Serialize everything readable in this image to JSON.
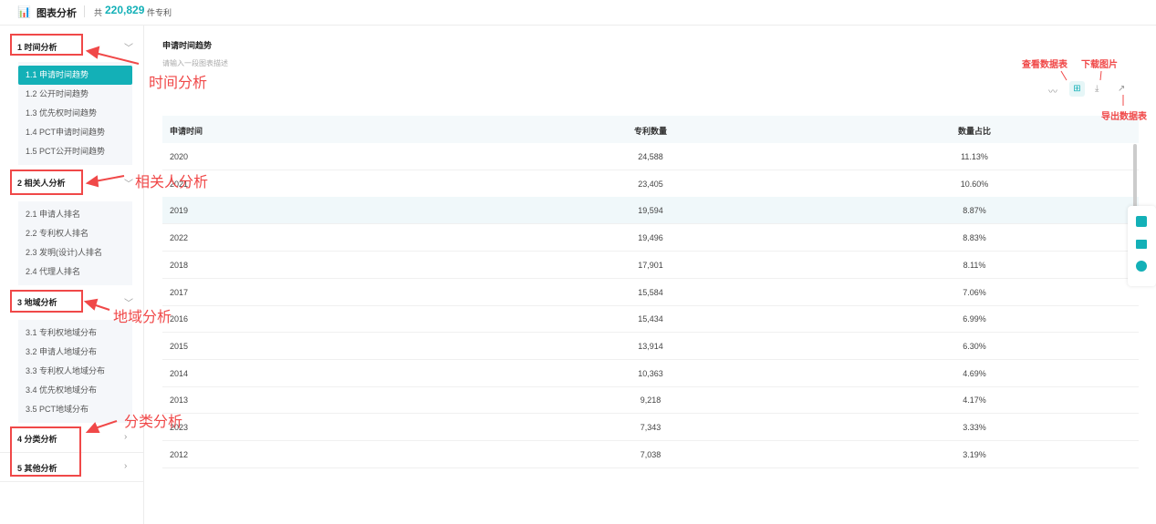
{
  "header": {
    "title": "图表分析",
    "count_prefix": "共",
    "count": "220,829",
    "count_suffix": "件专利"
  },
  "sidebar": {
    "sections": [
      {
        "label": "1 时间分析",
        "items": [
          "1.1 申请时间趋势",
          "1.2 公开时间趋势",
          "1.3 优先权时间趋势",
          "1.4 PCT申请时间趋势",
          "1.5 PCT公开时间趋势"
        ]
      },
      {
        "label": "2 相关人分析",
        "items": [
          "2.1 申请人排名",
          "2.2 专利权人排名",
          "2.3 发明(设计)人排名",
          "2.4 代理人排名"
        ]
      },
      {
        "label": "3 地域分析",
        "items": [
          "3.1 专利权地域分布",
          "3.2 申请人地域分布",
          "3.3 专利权人地域分布",
          "3.4 优先权地域分布",
          "3.5 PCT地域分布"
        ]
      },
      {
        "label": "4 分类分析",
        "items": []
      },
      {
        "label": "5 其他分析",
        "items": []
      }
    ]
  },
  "main": {
    "title": "申请时间趋势",
    "description_placeholder": "请输入一段图表描述",
    "table": {
      "headers": [
        "申请时间",
        "专利数量",
        "数量占比"
      ],
      "rows": [
        [
          "2020",
          "24,588",
          "11.13%"
        ],
        [
          "2021",
          "23,405",
          "10.60%"
        ],
        [
          "2019",
          "19,594",
          "8.87%"
        ],
        [
          "2022",
          "19,496",
          "8.83%"
        ],
        [
          "2018",
          "17,901",
          "8.11%"
        ],
        [
          "2017",
          "15,584",
          "7.06%"
        ],
        [
          "2016",
          "15,434",
          "6.99%"
        ],
        [
          "2015",
          "13,914",
          "6.30%"
        ],
        [
          "2014",
          "10,363",
          "4.69%"
        ],
        [
          "2013",
          "9,218",
          "4.17%"
        ],
        [
          "2023",
          "7,343",
          "3.33%"
        ],
        [
          "2012",
          "7,038",
          "3.19%"
        ]
      ]
    }
  },
  "annotations": {
    "time": "时间分析",
    "people": "相关人分析",
    "region": "地域分析",
    "category": "分类分析",
    "view_table": "查看数据表",
    "download_image": "下载图片",
    "export_table": "导出数据表"
  },
  "colors": {
    "accent": "#13b0b7",
    "annotation": "#f04848"
  }
}
